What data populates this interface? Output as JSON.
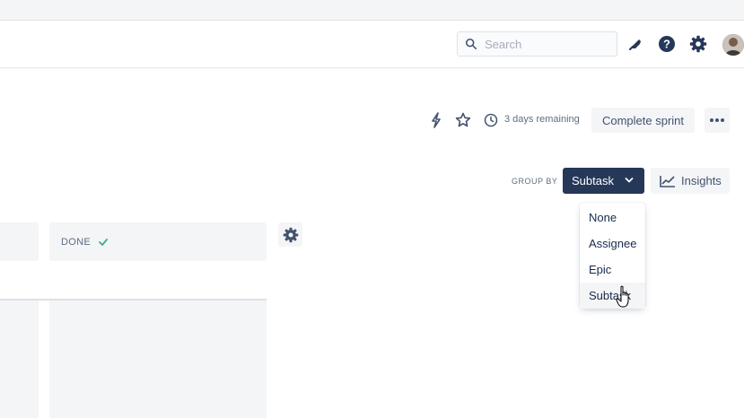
{
  "header": {
    "search": {
      "placeholder": "Search"
    },
    "icons": [
      "notifications-icon",
      "help-icon",
      "settings-icon"
    ]
  },
  "sprint": {
    "days_remaining": "3 days remaining",
    "complete_label": "Complete sprint"
  },
  "group_by": {
    "label": "GROUP BY",
    "selected": "Subtask",
    "options": [
      "None",
      "Assignee",
      "Epic",
      "Subtask"
    ]
  },
  "insights": {
    "label": "Insights"
  },
  "board": {
    "columns": [
      {
        "title": "DONE"
      }
    ]
  },
  "colors": {
    "primary_dark": "#253858",
    "text": "#172b4d",
    "subtle_text": "#5e6c84",
    "column_bg": "#f4f5f7",
    "done_check": "#36b37e"
  }
}
